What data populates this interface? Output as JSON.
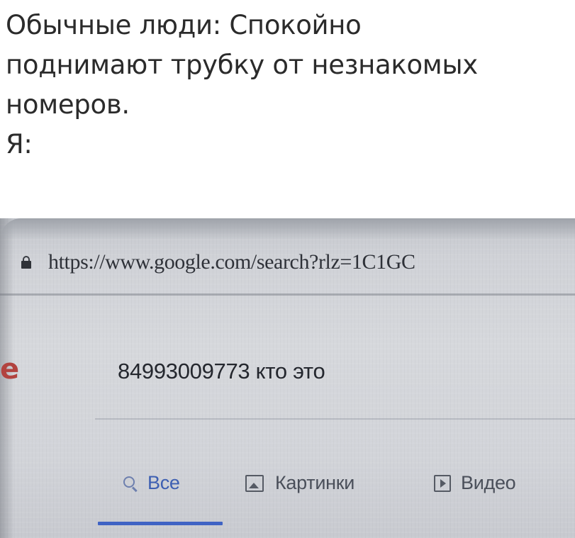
{
  "caption": {
    "line1": "Обычные люди: Спокойно",
    "line2": "поднимают трубку от незнакомых",
    "line3": "номеров.",
    "line4": "Я:"
  },
  "browser": {
    "url": "https://www.google.com/search?rlz=1C1GC",
    "logo_fragment": "e",
    "search_query": "84993009773 кто это",
    "tabs": [
      {
        "label": "Все",
        "icon": "search-icon",
        "active": true
      },
      {
        "label": "Картинки",
        "icon": "image-icon",
        "active": false
      },
      {
        "label": "Видео",
        "icon": "play-icon",
        "active": false
      }
    ]
  },
  "colors": {
    "active_tab": "#3f63c4",
    "logo_red": "#b2433f"
  }
}
